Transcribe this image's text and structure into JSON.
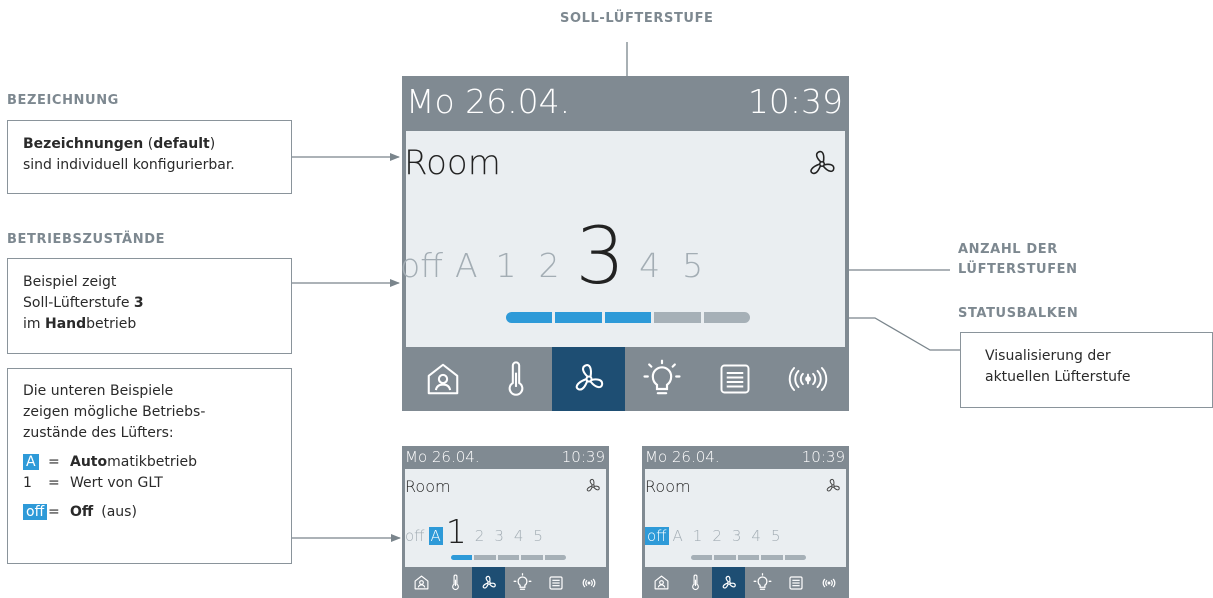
{
  "labels": {
    "soll": "SOLL-LÜFTERSTUFE",
    "bezeichnung": "BEZEICHNUNG",
    "betriebszustaende": "BETRIEBSZUSTÄNDE",
    "anzahl_line1": "ANZAHL DER",
    "anzahl_line2": "LÜFTERSTUFEN",
    "statusbalken": "STATUSBALKEN"
  },
  "boxes": {
    "bezeichnungen": {
      "strong1": "Bezeichnungen",
      "plain1": " (",
      "strong2": "default",
      "plain2": ")",
      "line2": "sind individuell konfigurierbar."
    },
    "beispiel": {
      "line1": "Beispiel zeigt",
      "line2_plain": "Soll-Lüfterstufe ",
      "line2_strong": "3",
      "line3_plain1": "im ",
      "line3_strong": "Hand",
      "line3_plain2": "betrieb"
    },
    "untere": {
      "line1": "Die unteren Beispiele",
      "line2": "zeigen mögliche Betriebs-",
      "line3": "zustände des Lüfters:",
      "a_key": "A",
      "a_eq": "=",
      "a_strong": "Auto",
      "a_plain": "matikbetrieb",
      "one_key": "1",
      "one_eq": "=",
      "one_text": "Wert von GLT",
      "off_key": "off",
      "off_eq": "=",
      "off_strong": "Off",
      "off_plain": "(aus)"
    },
    "visualisierung": {
      "line1": "Visualisierung der",
      "line2": "aktuellen Lüfterstufe"
    }
  },
  "devices": {
    "main": {
      "date": "Mo 26.04.",
      "time": "10:39",
      "name": "Room",
      "levels": [
        "off",
        "A",
        "1",
        "2",
        "3",
        "4",
        "5"
      ],
      "active_level": "3",
      "bar_filled": 3,
      "bar_total": 5,
      "icons": [
        "home-icon",
        "thermometer-icon",
        "fan-icon",
        "light-bulb-icon",
        "blinds-icon",
        "broadcast-icon"
      ],
      "selected_icon": "fan-icon"
    },
    "auto": {
      "date": "Mo 26.04.",
      "time": "10:39",
      "name": "Room",
      "levels": [
        "off",
        "A",
        "1",
        "2",
        "3",
        "4",
        "5"
      ],
      "active_level": "1",
      "highlighted": "A",
      "bar_filled": 1,
      "bar_total": 5
    },
    "off": {
      "date": "Mo 26.04.",
      "time": "10:39",
      "name": "Room",
      "levels": [
        "off",
        "A",
        "1",
        "2",
        "3",
        "4",
        "5"
      ],
      "highlighted": "off",
      "bar_filled": 0,
      "bar_total": 5
    }
  },
  "colors": {
    "accent": "#2e9ad8",
    "nav_selected": "#1e4e73",
    "device_frame": "#808a92",
    "screen": "#eaeef1",
    "label": "#7d8890"
  }
}
